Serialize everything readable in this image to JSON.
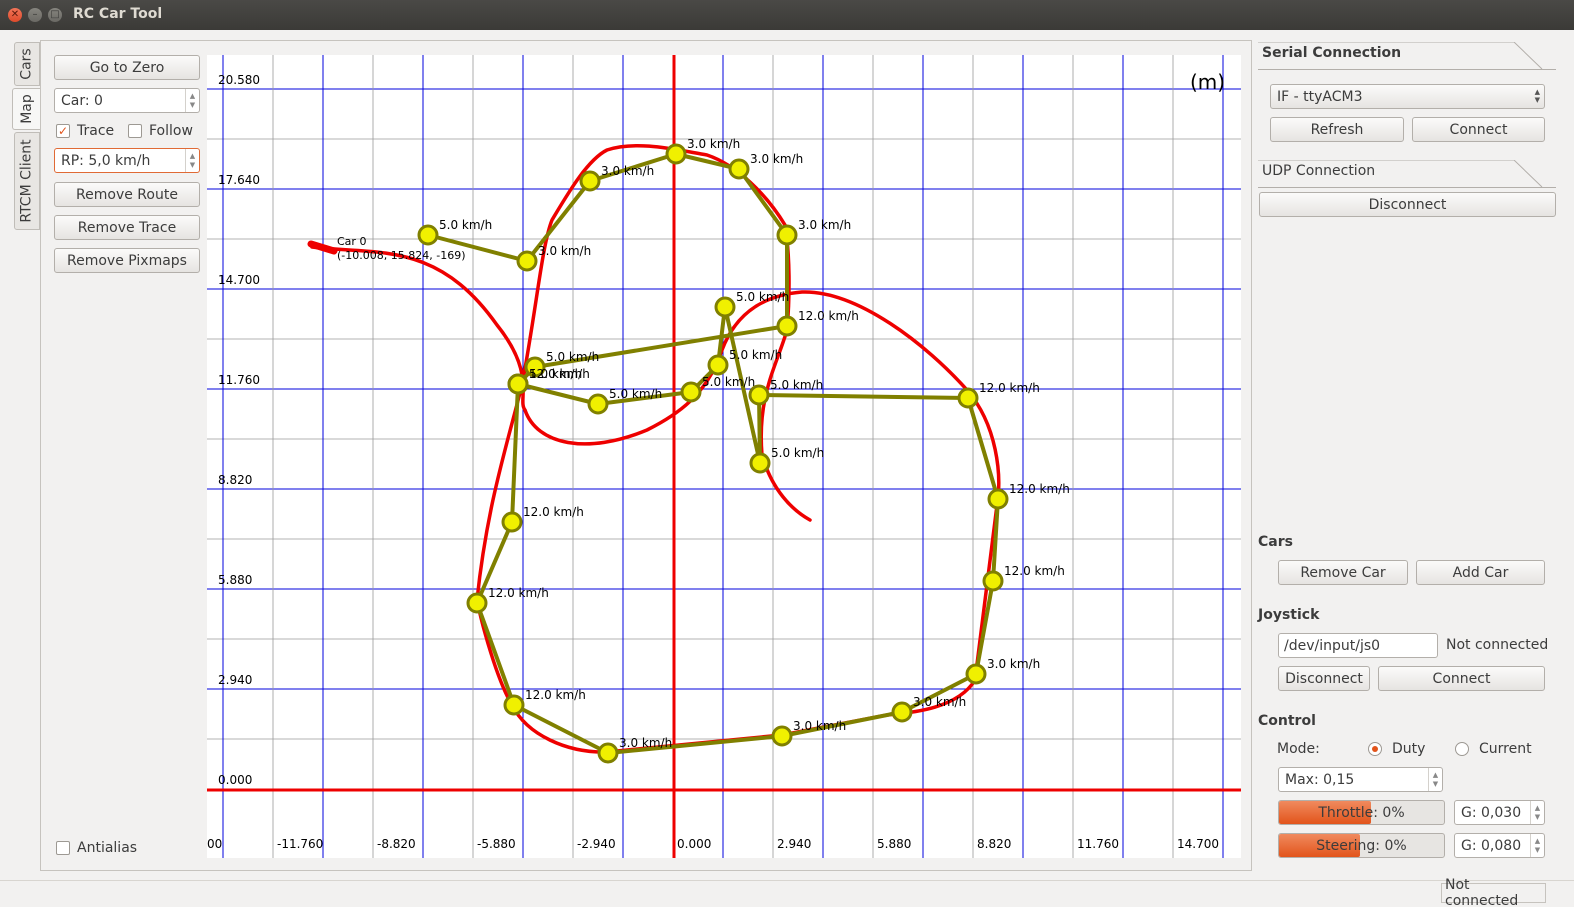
{
  "window": {
    "title": "RC Car Tool"
  },
  "tabs": [
    {
      "label": "Cars"
    },
    {
      "label": "Map"
    },
    {
      "label": "RTCM Client"
    }
  ],
  "left_panel": {
    "go_to_zero": "Go to Zero",
    "car_spin": "Car: 0",
    "trace_label": "Trace",
    "trace_checked": true,
    "follow_label": "Follow",
    "follow_checked": false,
    "rp_spin": "RP: 5,0 km/h",
    "remove_route": "Remove Route",
    "remove_trace": "Remove Trace",
    "remove_pixmaps": "Remove Pixmaps",
    "antialias_label": "Antialias",
    "antialias_checked": false
  },
  "map": {
    "unit_label": "(m)",
    "y_ticks": [
      "20.580",
      "17.640",
      "14.700",
      "11.760",
      "8.820",
      "5.880",
      "2.940",
      "0.000"
    ],
    "x_ticks": [
      "00",
      "-11.760",
      "-8.820",
      "-5.880",
      "-2.940",
      "0.000",
      "2.940",
      "5.880",
      "8.820",
      "11.760",
      "14.700"
    ],
    "car": {
      "name": "Car 0",
      "pose": "(-10.008, 15.824, -169)"
    },
    "waypoint_labels": [
      "5.0 km/h",
      "3.0 km/h",
      "3.0 km/h",
      "3.0 km/h",
      "3.0 km/h",
      "3.0 km/h",
      "12.0 km/h",
      "5.0 km/h",
      "12.0 km/h",
      "12.0 km/h",
      "12.0 km/h",
      "12.0 km/h",
      "3.0 km/h",
      "3.0 km/h",
      "3.0 km/h",
      "3.0 km/h",
      "12.0 km/h",
      "12.0 km/h",
      "12.0 km/h",
      "5.0 km/h",
      "5.0 km/h",
      "5.0 km/h",
      "5.0 km/h",
      "5.0 km/h",
      "5.0 km/h",
      "5.0 km/h"
    ],
    "colors": {
      "grid": "#0000dd",
      "axis": "#ee0000",
      "trace": "#ee0000",
      "route": "#808000",
      "waypoint": "#f0f000"
    }
  },
  "right_panel": {
    "serial": {
      "title": "Serial Connection",
      "port": "IF - ttyACM3",
      "refresh": "Refresh",
      "connect": "Connect"
    },
    "udp": {
      "title": "UDP Connection",
      "disconnect": "Disconnect"
    },
    "cars": {
      "title": "Cars",
      "remove_car": "Remove Car",
      "add_car": "Add Car"
    },
    "joystick": {
      "title": "Joystick",
      "device": "/dev/input/js0",
      "status": "Not connected",
      "disconnect": "Disconnect",
      "connect": "Connect"
    },
    "control": {
      "title": "Control",
      "mode_label": "Mode:",
      "duty_label": "Duty",
      "current_label": "Current",
      "mode": "Duty",
      "max_spin": "Max: 0,15",
      "throttle_text": "Throttle: 0%",
      "throttle_fill": 0.56,
      "throttle_gain": "G: 0,030",
      "steering_text": "Steering: 0%",
      "steering_fill": 0.49,
      "steering_gain": "G: 0,080",
      "accent": "#e2541b"
    }
  },
  "statusbar": {
    "text": "Not connected"
  }
}
